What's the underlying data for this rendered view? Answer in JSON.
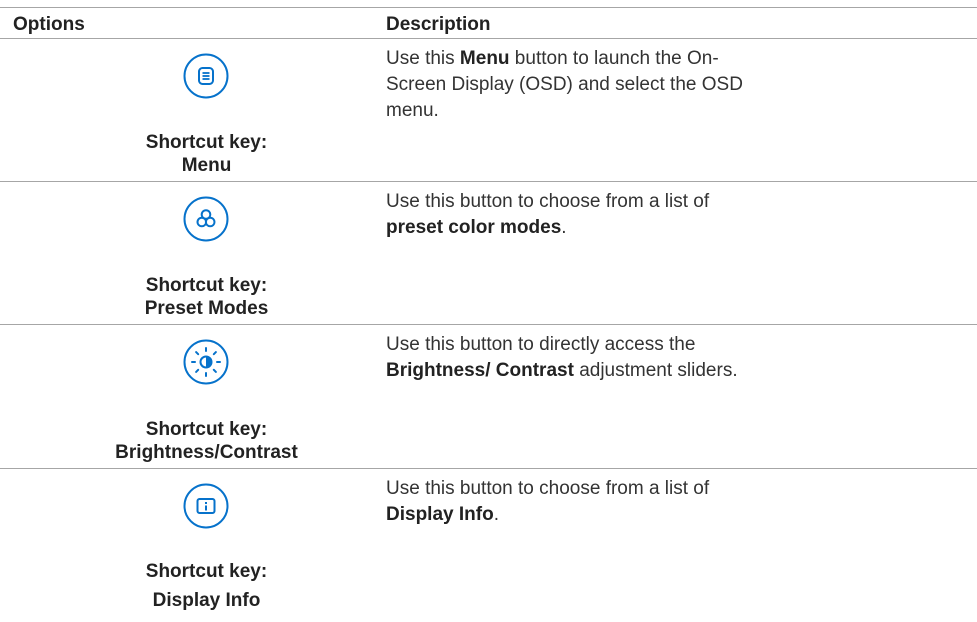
{
  "header": {
    "options": "Options",
    "description": "Description"
  },
  "colors": {
    "icon_blue": "#0672CB",
    "rule_gray": "#A6A6A6",
    "text": "#333333"
  },
  "rows": [
    {
      "icon": "menu-icon",
      "shortcut_line1": "Shortcut key:",
      "shortcut_line2": "Menu",
      "desc_pre": "Use this ",
      "desc_bold": "Menu",
      "desc_post": " button to launch the On-Screen Display (OSD) and select the OSD menu."
    },
    {
      "icon": "preset-modes-icon",
      "shortcut_line1": "Shortcut key:",
      "shortcut_line2": "Preset Modes",
      "desc_pre": "Use this button to choose from a list of ",
      "desc_bold": "preset color modes",
      "desc_post": "."
    },
    {
      "icon": "brightness-contrast-icon",
      "shortcut_line1": "Shortcut key:",
      "shortcut_line2": "Brightness/Contrast",
      "desc_pre": "Use this button to directly access the ",
      "desc_bold": "Brightness/ Contrast",
      "desc_post": " adjustment sliders."
    },
    {
      "icon": "display-info-icon",
      "shortcut_line1": "Shortcut key:",
      "shortcut_line2": "Display Info",
      "desc_pre": "Use this button to choose from a list of ",
      "desc_bold": "Display Info",
      "desc_post": "."
    }
  ]
}
